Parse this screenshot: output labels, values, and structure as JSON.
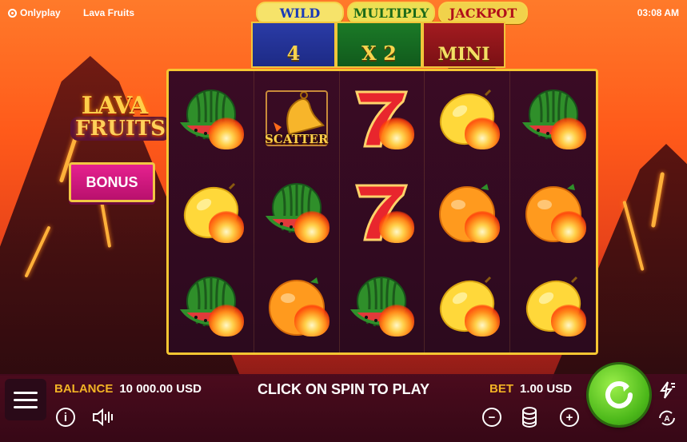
{
  "header": {
    "brand": "Onlyplay",
    "game_name": "Lava Fruits",
    "clock": "03:08 AM"
  },
  "features": {
    "tabs": [
      "WILD",
      "MULTIPLY",
      "JACKPOT"
    ],
    "panels": [
      "4",
      "X 2",
      "MINI"
    ]
  },
  "logo": {
    "line1": "LAVA",
    "line2": "FRUITS"
  },
  "bonus_label": "BONUS",
  "reels": [
    [
      "watermelon",
      "scatter-bell",
      "seven",
      "lemon",
      "watermelon"
    ],
    [
      "lemon",
      "watermelon",
      "seven",
      "orange",
      "orange"
    ],
    [
      "watermelon",
      "orange",
      "watermelon",
      "lemon",
      "lemon"
    ]
  ],
  "scatter_label": "SCATTER",
  "bottom": {
    "balance_label": "BALANCE",
    "balance_value": "10 000.00 USD",
    "message": "CLICK ON SPIN TO PLAY",
    "bet_label": "BET",
    "bet_value": "1.00 USD"
  },
  "colors": {
    "accent_gold": "#f2b325",
    "spin_green": "#4cb81a",
    "bonus_pink": "#e6218f",
    "reel_bg": "#2c0a1e"
  },
  "icons": [
    "menu-icon",
    "info-icon",
    "sound-icon",
    "minus-icon",
    "coins-icon",
    "plus-icon",
    "turbo-icon",
    "autoplay-icon",
    "spin-icon"
  ]
}
